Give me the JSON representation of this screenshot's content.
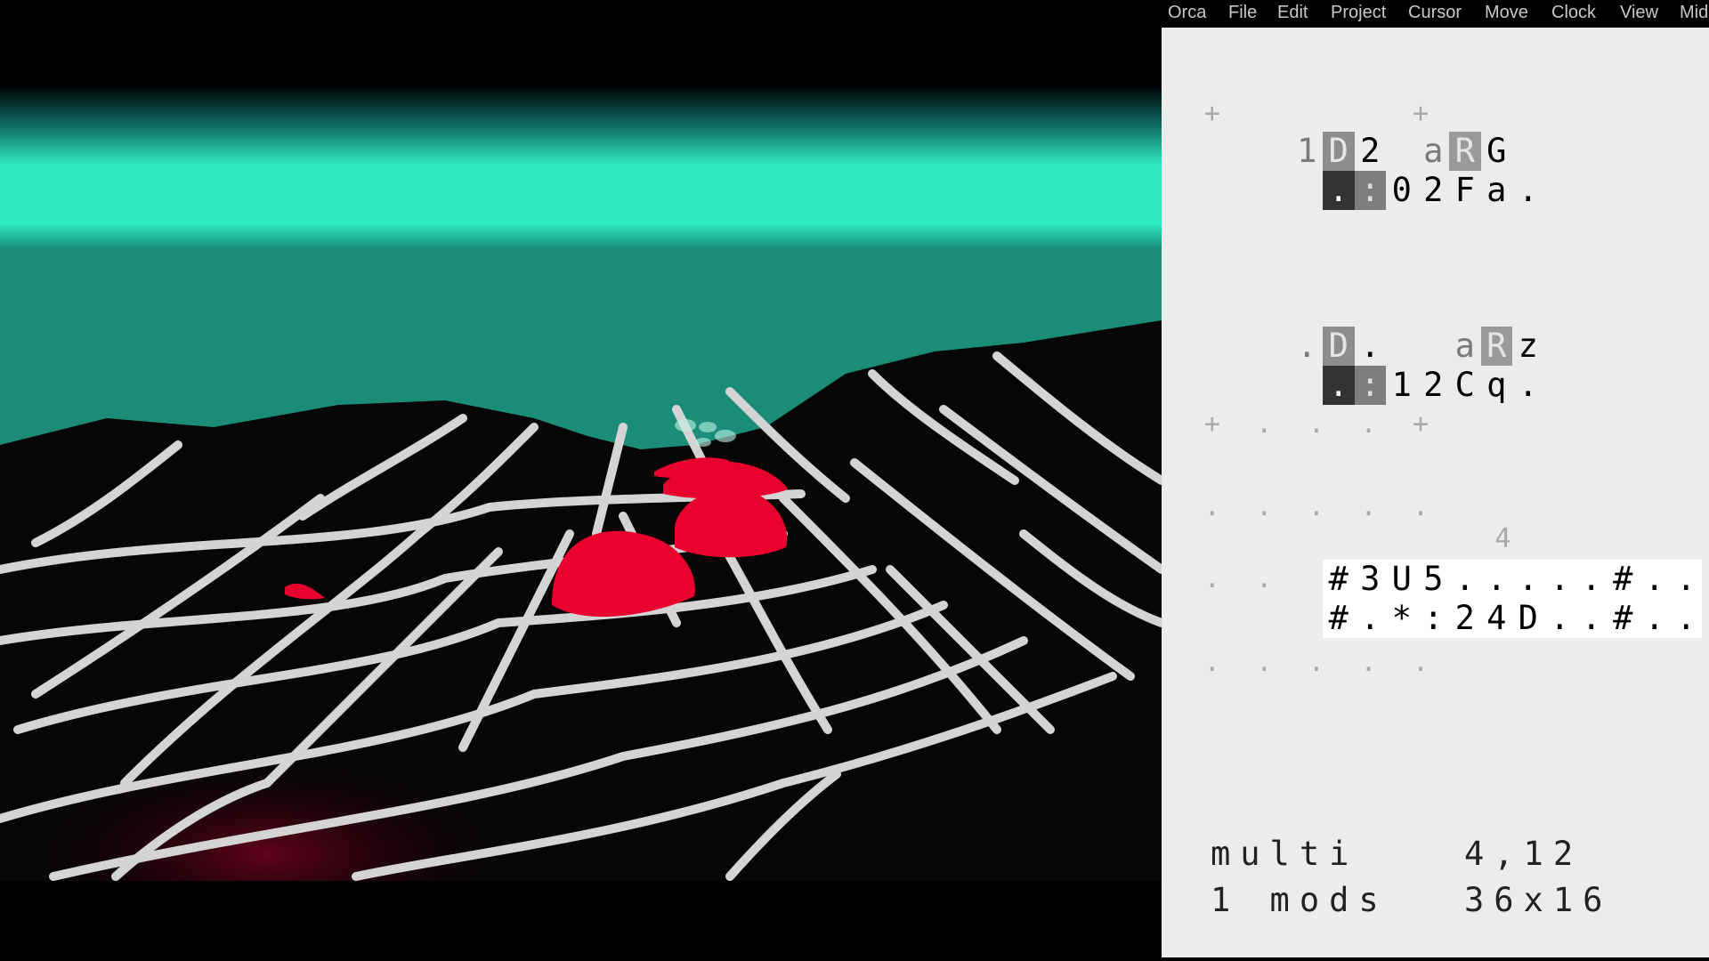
{
  "menubar": {
    "items": [
      {
        "label": "Orca"
      },
      {
        "label": "File"
      },
      {
        "label": "Edit"
      },
      {
        "label": "Project"
      },
      {
        "label": "Cursor"
      },
      {
        "label": "Move"
      },
      {
        "label": "Clock"
      },
      {
        "label": "View"
      },
      {
        "label": "Mid"
      }
    ]
  },
  "grid": {
    "rows": [
      [
        "+",
        "+"
      ],
      [
        "1",
        "D",
        "2",
        "a",
        "R",
        "G"
      ],
      [
        ".",
        ":",
        "0",
        "2",
        "F",
        "a",
        "."
      ],
      [
        ".",
        "D",
        ".",
        "a",
        "R",
        "z"
      ],
      [
        ".",
        ":",
        "1",
        "2",
        "C",
        "q",
        "."
      ],
      [
        "+",
        ".",
        ".",
        ".",
        "+"
      ],
      [
        ".",
        ".",
        ".",
        ".",
        "."
      ],
      [
        "4"
      ],
      [
        ".",
        ".",
        "#",
        "3",
        "U",
        "5",
        ".",
        ".",
        ".",
        ".",
        ".",
        "#",
        ".",
        "."
      ],
      [
        "#",
        ".",
        "*",
        ":",
        "2",
        "4",
        "D",
        ".",
        ".",
        "#",
        ".",
        "."
      ],
      [
        ".",
        ".",
        ".",
        ".",
        "."
      ]
    ]
  },
  "status": {
    "line1_left": "multi",
    "line1_right": "4,12",
    "line2_left": "1 mods",
    "line2_right": "36x16"
  },
  "colors": {
    "scene_glow": "#2ee8c0",
    "orbs": "#e8002e",
    "grid_lines": "#cfcfcf",
    "panel_bg": "#ececec"
  }
}
